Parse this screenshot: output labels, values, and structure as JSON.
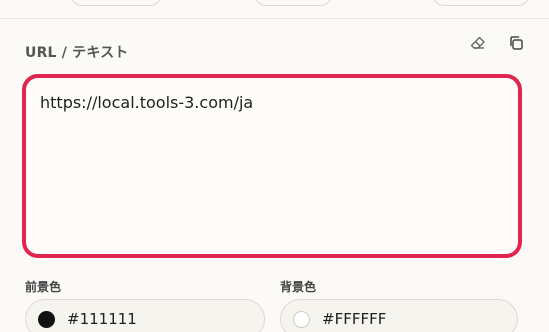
{
  "input_section": {
    "label": "URL / テキスト",
    "value": "https://local.tools-3.com/ja",
    "clear_icon": "eraser-icon",
    "copy_icon": "copy-icon",
    "accent_color": "#e0264f"
  },
  "colors": {
    "foreground": {
      "label": "前景色",
      "value": "#111111",
      "swatch": "#111111"
    },
    "background": {
      "label": "背景色",
      "value": "#FFFFFF",
      "swatch": "#FFFFFF"
    }
  }
}
